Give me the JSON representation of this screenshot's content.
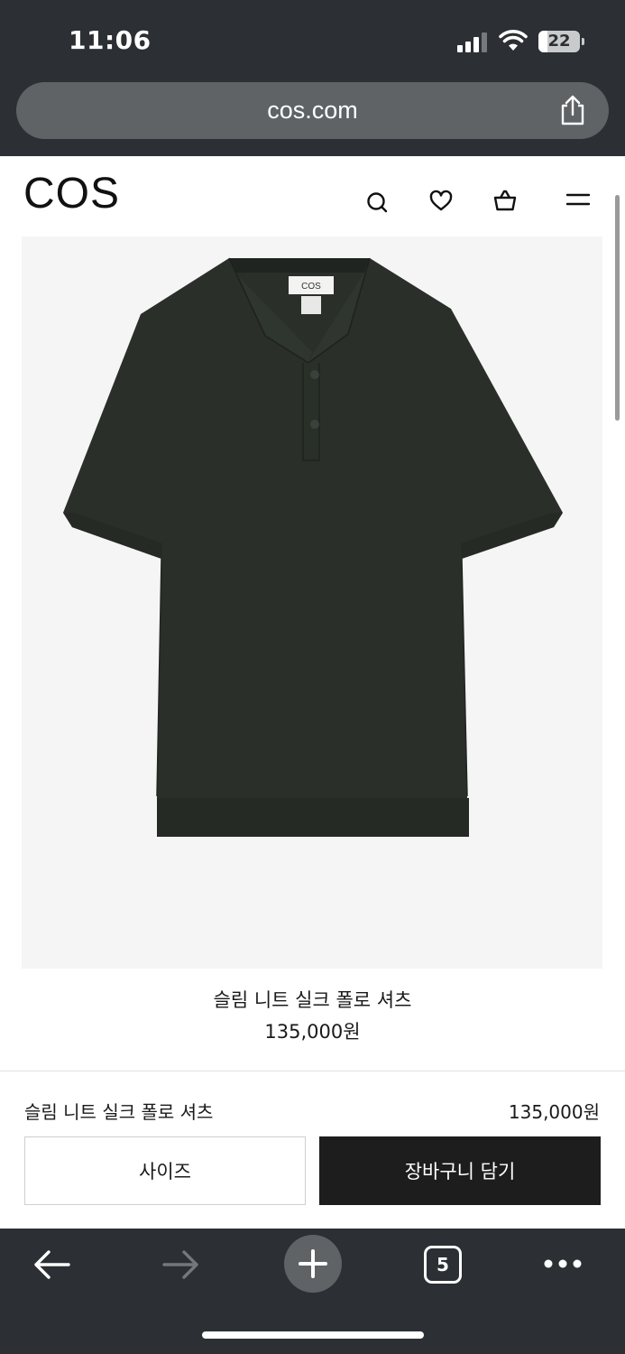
{
  "status_bar": {
    "time": "11:06",
    "battery": "22",
    "battery_level": 0.22,
    "icons": [
      "signal-icon",
      "wifi-icon",
      "battery-icon"
    ]
  },
  "browser": {
    "url": "cos.com",
    "share_icon": "share-icon",
    "open_tabs": "5",
    "bottom_icons": [
      "back-arrow-icon",
      "forward-arrow-icon",
      "plus-icon",
      "tabs-icon",
      "more-icon"
    ]
  },
  "site_header": {
    "logo": "COS",
    "icons": [
      "search-icon",
      "heart-icon",
      "bag-icon",
      "menu-icon"
    ]
  },
  "product": {
    "name": "슬림 니트 실크 폴로 셔츠",
    "price": "135,000원",
    "image_label": "COS",
    "image_bg": "#f5f5f5",
    "shirt_color": "#2a2f2a"
  },
  "buy_bar": {
    "name": "슬림 니트 실크 폴로 셔츠",
    "price": "135,000원",
    "size_label": "사이즈",
    "cart_label": "장바구니 담기"
  }
}
